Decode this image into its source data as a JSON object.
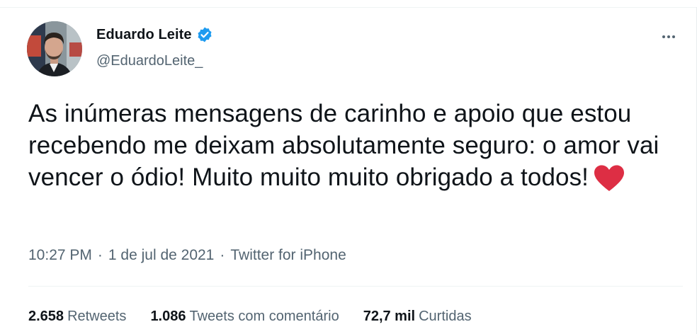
{
  "author": {
    "name": "Eduardo Leite",
    "handle": "@EduardoLeite_",
    "verified_color": "#1d9bf0"
  },
  "tweet": {
    "text": "As inúmeras mensagens de carinho e apoio que estou recebendo me deixam absolutamente seguro: o amor vai vencer o ódio! Muito muito muito obrigado a todos!",
    "emoji": "heart-icon",
    "emoji_color": "#dd2e44"
  },
  "meta": {
    "time": "10:27 PM",
    "separator": "·",
    "date": "1 de jul de 2021",
    "source": "Twitter for iPhone"
  },
  "stats": [
    {
      "value": "2.658",
      "label": "Retweets"
    },
    {
      "value": "1.086",
      "label": "Tweets com comentário"
    },
    {
      "value": "72,7 mil",
      "label": "Curtidas"
    }
  ],
  "icons": {
    "more": "more-options-icon",
    "verified": "verified-badge-icon"
  }
}
